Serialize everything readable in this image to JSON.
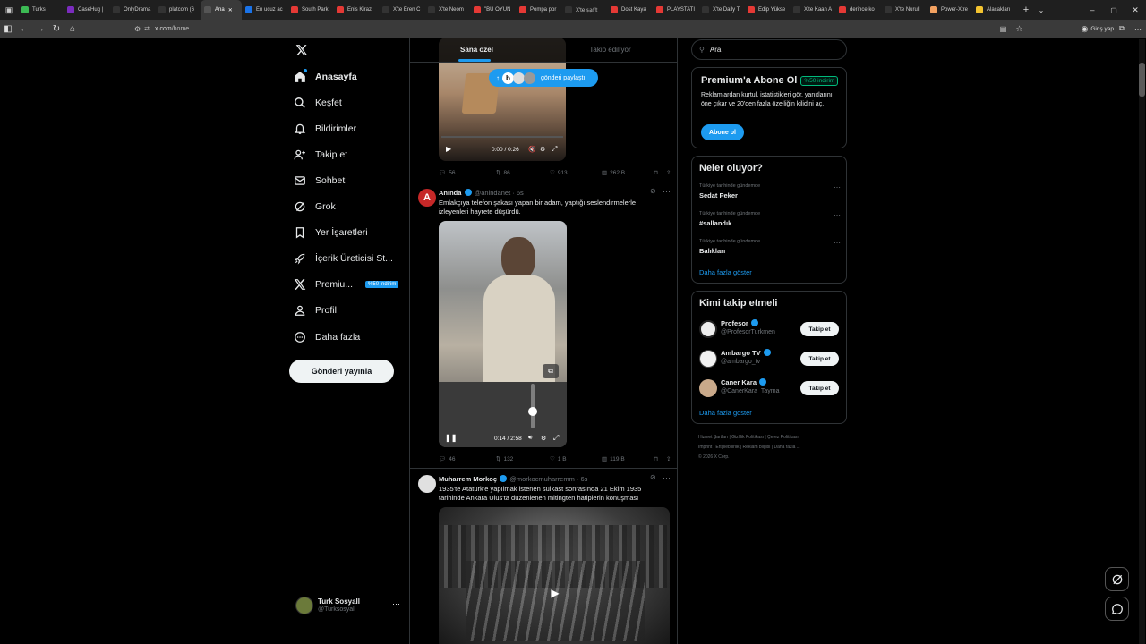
{
  "browser": {
    "tabs": [
      {
        "label": "Turks",
        "color": "#3cba54"
      },
      {
        "label": "CaseHug |",
        "color": "#7b2cbf"
      },
      {
        "label": "OnlyDrama",
        "color": "#333"
      },
      {
        "label": "platcom (6",
        "color": "#333"
      },
      {
        "label": "Ana",
        "color": "#555",
        "active": true
      },
      {
        "label": "En ucuz ac",
        "color": "#1a73e8"
      },
      {
        "label": "South Park",
        "color": "#e53935"
      },
      {
        "label": "Enis Kiraz",
        "color": "#e53935"
      },
      {
        "label": "X'te Eren C",
        "color": "#333"
      },
      {
        "label": "X'te Neom",
        "color": "#333"
      },
      {
        "label": "\"BU OYUN",
        "color": "#e53935"
      },
      {
        "label": "Pompa por",
        "color": "#e53935"
      },
      {
        "label": "X'te 𝕤𝕒𝕗𝕥",
        "color": "#333"
      },
      {
        "label": "Dost Kaya",
        "color": "#e53935"
      },
      {
        "label": "PLAYSTATI",
        "color": "#e53935"
      },
      {
        "label": "X'te Daily T",
        "color": "#333"
      },
      {
        "label": "Edip Yükse",
        "color": "#e53935"
      },
      {
        "label": "X'te Kaan A",
        "color": "#333"
      },
      {
        "label": "derince ko",
        "color": "#e53935"
      },
      {
        "label": "X'te Nurull",
        "color": "#333"
      },
      {
        "label": "Power-Xtre",
        "color": "#f4a261"
      },
      {
        "label": "Alacakları",
        "color": "#f4c430"
      }
    ],
    "url_host": "x.com",
    "url_path": "/home",
    "signin_label": "Giriş yap"
  },
  "nav": {
    "home": "Anasayfa",
    "explore": "Keşfet",
    "notifications": "Bildirimler",
    "follow": "Takip et",
    "chat": "Sohbet",
    "grok": "Grok",
    "bookmarks": "Yer İşaretleri",
    "creator": "İçerik Üreticisi St...",
    "premium": "Premiu...",
    "premium_badge": "%50 indirim",
    "profile": "Profil",
    "more": "Daha fazla",
    "post_button": "Gönderi yayınla",
    "account_name": "Turk Sosyall",
    "account_handle": "@Turksosyall"
  },
  "timeline": {
    "tab_foryou": "Sana özel",
    "tab_following": "Takip ediliyor",
    "new_posts_pill": "gönderi paylaştı",
    "post1": {
      "time": "0:00 / 0:26",
      "replies": "56",
      "reposts": "86",
      "likes": "913",
      "views": "262 B"
    },
    "post2": {
      "name": "Anında",
      "handle": "@anindanet",
      "age": "· 6s",
      "text": "Emlakçıya telefon şakası yapan bir adam, yaptığı seslendirmelerle izleyenleri hayrete düşürdü.",
      "time": "0:14 / 2:58",
      "replies": "46",
      "reposts": "132",
      "likes": "1 B",
      "views": "119 B"
    },
    "post3": {
      "name": "Muharrem Morkoç",
      "handle": "@morkocmuharremm",
      "age": "· 6s",
      "text": "1935'te Atatürk'e yapılmak istenen suikast sonrasında 21 Ekim 1935 tarihinde Ankara Ulus'ta düzenlenen mitingten hatiplerin konuşması"
    }
  },
  "sidebar": {
    "search_placeholder": "Ara",
    "premium_title": "Premium'a Abone Ol",
    "premium_badge": "%50 indirim",
    "premium_text": "Reklamlardan kurtul, istatistikleri gör, yanıtlarını öne çıkar ve 20'den fazla özelliğin kilidini aç.",
    "premium_button": "Abone ol",
    "trends_title": "Neler oluyor?",
    "trends": [
      {
        "meta": "Türkiye tarihinde gündemde",
        "name": "Sedat Peker"
      },
      {
        "meta": "Türkiye tarihinde gündemde",
        "name": "#sallandık"
      },
      {
        "meta": "Türkiye tarihinde gündemde",
        "name": "Balıkları"
      }
    ],
    "show_more": "Daha fazla göster",
    "who_title": "Kimi takip etmeli",
    "who": [
      {
        "name": "Profesor",
        "handle": "@ProfesorTurkmen"
      },
      {
        "name": "Ambargo TV",
        "handle": "@ambargo_tv"
      },
      {
        "name": "Caner Kara",
        "handle": "@CanerKara_Tayma"
      }
    ],
    "follow_label": "Takip et",
    "footer1": "Hizmet Şartları  |  Gizlilik Politikası  |  Çerez Politikası  |",
    "footer2": "Imprint  |  Erişilebilirlik  |  Reklam bilgisi  |  Daha fazla ...",
    "footer3": "© 2026 X Corp."
  }
}
